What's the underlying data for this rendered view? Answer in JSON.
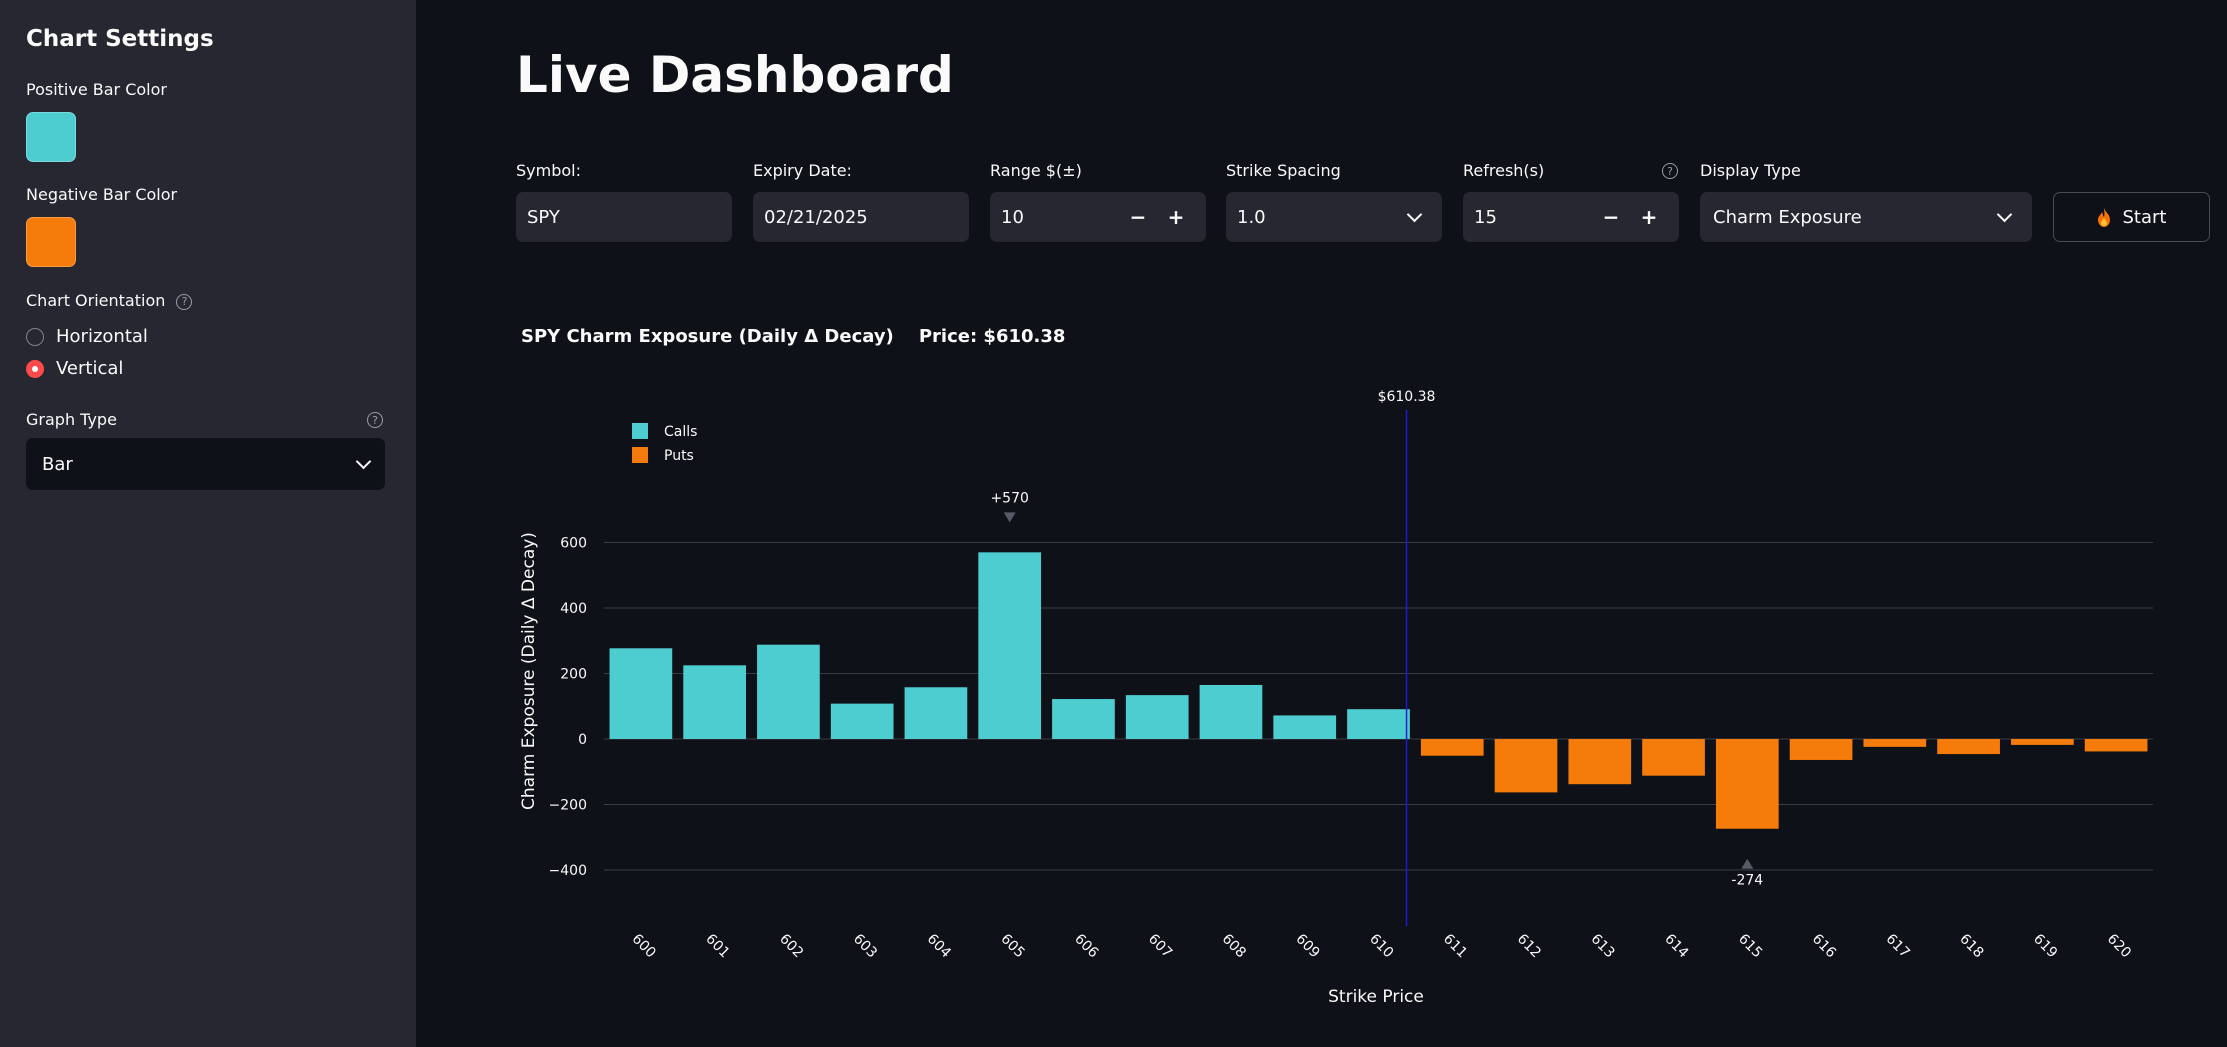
{
  "sidebar": {
    "title": "Chart Settings",
    "positive_label": "Positive Bar Color",
    "positive_color": "#4ecdd0",
    "negative_label": "Negative Bar Color",
    "negative_color": "#f57c0a",
    "orientation_label": "Chart Orientation",
    "orientation_options": [
      "Horizontal",
      "Vertical"
    ],
    "orientation_selected": "Vertical",
    "graph_type_label": "Graph Type",
    "graph_type_value": "Bar",
    "help_icon": "?"
  },
  "main": {
    "title": "Live Dashboard",
    "controls": {
      "symbol_label": "Symbol:",
      "symbol_value": "SPY",
      "expiry_label": "Expiry Date:",
      "expiry_value": "02/21/2025",
      "range_label": "Range $(±)",
      "range_value": "10",
      "spacing_label": "Strike Spacing",
      "spacing_value": "1.0",
      "refresh_label": "Refresh(s)",
      "refresh_value": "15",
      "display_label": "Display Type",
      "display_value": "Charm Exposure",
      "start_label": "Start",
      "minus": "−",
      "plus": "+"
    },
    "chart_title": "SPY Charm Exposure (Daily Δ Decay)    Price: $610.38"
  },
  "chart_data": {
    "type": "bar",
    "title": "SPY Charm Exposure (Daily Δ Decay)    Price: $610.38",
    "xlabel": "Strike Price",
    "ylabel": "Charm Exposure (Daily Δ Decay)",
    "ylim": [
      -400,
      700
    ],
    "yticks": [
      -400,
      -200,
      0,
      200,
      400,
      600
    ],
    "ytick_labels": [
      "−400",
      "−200",
      "0",
      "200",
      "400",
      "600"
    ],
    "categories": [
      "600",
      "601",
      "602",
      "603",
      "604",
      "605",
      "606",
      "607",
      "608",
      "609",
      "610",
      "611",
      "612",
      "613",
      "614",
      "615",
      "616",
      "617",
      "618",
      "619",
      "620"
    ],
    "series": [
      {
        "name": "Calls",
        "color": "#4ecdd0",
        "values": [
          277,
          225,
          288,
          108,
          158,
          570,
          122,
          134,
          165,
          72,
          91,
          0,
          0,
          0,
          0,
          0,
          0,
          0,
          0,
          0,
          0
        ]
      },
      {
        "name": "Puts",
        "color": "#f57c0a",
        "values": [
          0,
          0,
          0,
          0,
          0,
          0,
          0,
          0,
          0,
          0,
          0,
          -51,
          -163,
          -138,
          -112,
          -274,
          -64,
          -24,
          -46,
          -18,
          -38
        ]
      }
    ],
    "price_line": {
      "value": 610.38,
      "label": "$610.38",
      "color": "#1a1ad8"
    },
    "annotations": [
      {
        "category": "605",
        "value": 570,
        "text": "+570"
      },
      {
        "category": "615",
        "value": -274,
        "text": "-274"
      }
    ],
    "legend": "top-left",
    "grid": true
  }
}
